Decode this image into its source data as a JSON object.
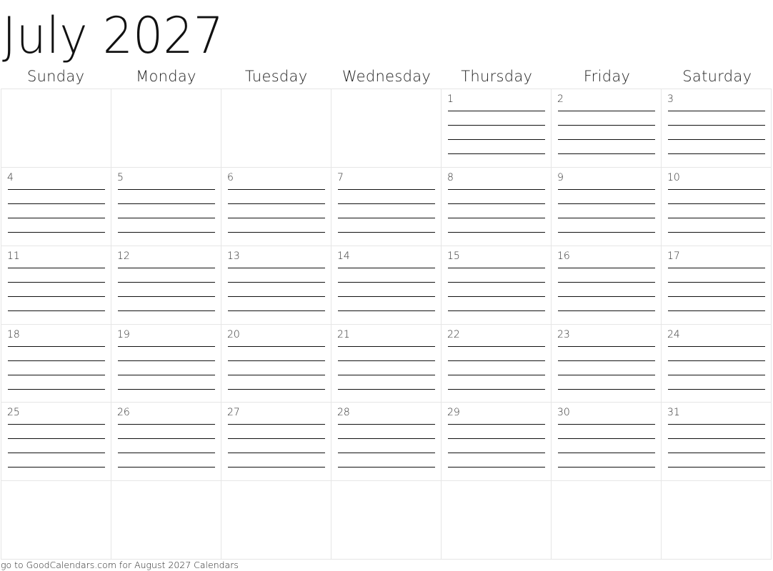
{
  "title": "July 2027",
  "weekdays": [
    "Sunday",
    "Monday",
    "Tuesday",
    "Wednesday",
    "Thursday",
    "Friday",
    "Saturday"
  ],
  "first_weekday_index": 4,
  "days_in_month": 31,
  "weeks_shown": 6,
  "lines_per_day": 4,
  "footer": "go to GoodCalendars.com for August 2027 Calendars",
  "colors": {
    "grid_border": "#e6e6e6",
    "writing_line": "#111111",
    "text": "#111111"
  }
}
